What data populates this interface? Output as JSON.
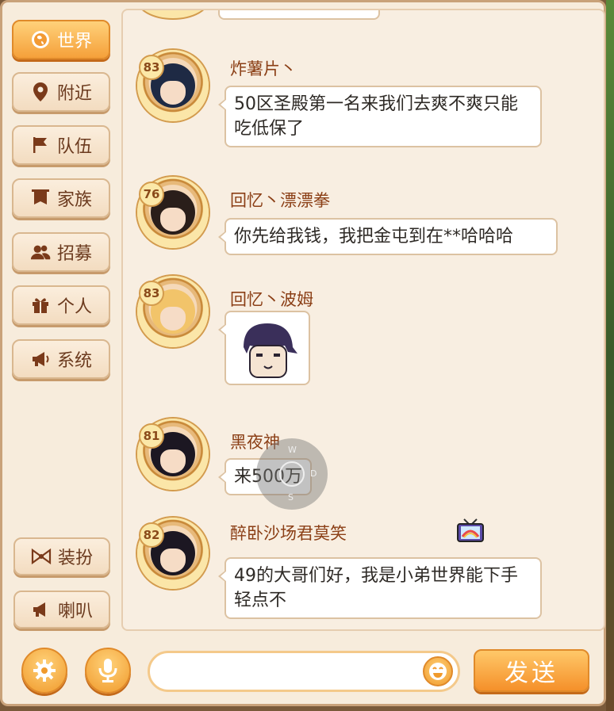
{
  "sidebar": {
    "tabs": [
      {
        "label": "世界",
        "icon": "globe-icon"
      },
      {
        "label": "附近",
        "icon": "location-pin-icon"
      },
      {
        "label": "队伍",
        "icon": "flag-icon"
      },
      {
        "label": "家族",
        "icon": "banner-icon"
      },
      {
        "label": "招募",
        "icon": "users-icon"
      },
      {
        "label": "个人",
        "icon": "gift-icon"
      },
      {
        "label": "系统",
        "icon": "megaphone-icon"
      }
    ],
    "bottom": [
      {
        "label": "装扮",
        "icon": "bow-icon"
      },
      {
        "label": "喇叭",
        "icon": "horn-icon"
      }
    ]
  },
  "messages": [
    {
      "level": "83",
      "name": "炸薯片丶",
      "text": "50区圣殿第一名来我们去爽不爽只能吃低保了"
    },
    {
      "level": "76",
      "name": "回忆丶漂漂拳",
      "text": "你先给我钱，我把金屯到在**哈哈哈"
    },
    {
      "level": "83",
      "name": "回忆丶波姆",
      "text": "",
      "sticker": "pixel-face-sticker"
    },
    {
      "level": "81",
      "name": "黑夜神",
      "text": "来500万"
    },
    {
      "level": "82",
      "name": "醉卧沙场君莫笑",
      "text": "49的大哥们好，我是小弟世界能下手轻点不"
    }
  ],
  "joystick": {
    "up": "W",
    "right": "D",
    "down": "S"
  },
  "footer": {
    "send_label": "发送",
    "settings_icon": "gear-icon",
    "mic_icon": "microphone-icon",
    "emoji_icon": "smiley-icon"
  },
  "colors": {
    "accent": "#f5a03a",
    "name": "#8b3f16",
    "panel": "#f7ecdc"
  }
}
